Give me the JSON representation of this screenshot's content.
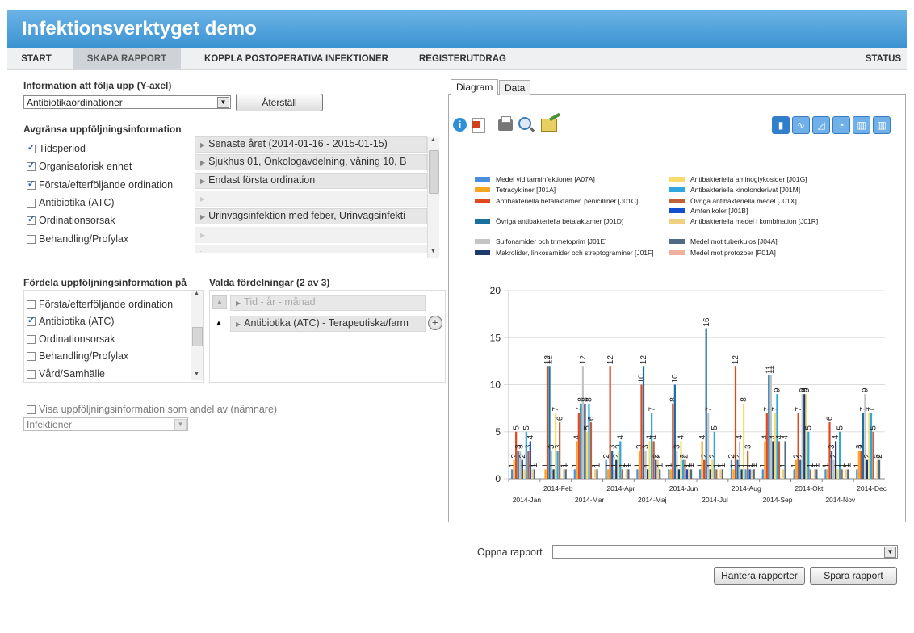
{
  "app": {
    "title": "Infektionsverktyget demo"
  },
  "nav": [
    {
      "label": "START",
      "active": false
    },
    {
      "label": "SKAPA RAPPORT",
      "active": true
    },
    {
      "label": "KOPPLA POSTOPERATIVA INFEKTIONER",
      "active": false
    },
    {
      "label": "REGISTERUTDRAG",
      "active": false
    },
    {
      "label": "STATUS",
      "active": false
    }
  ],
  "yaxis_section": {
    "heading": "Information att följa upp (Y-axel)",
    "select_value": "Antibiotikaordinationer",
    "reset_label": "Återställ"
  },
  "limit_section": {
    "heading": "Avgränsa uppföljningsinformation",
    "items": [
      {
        "label": "Tidsperiod",
        "checked": true,
        "filter": "Senaste året (2014-01-16 - 2015-01-15)"
      },
      {
        "label": "Organisatorisk enhet",
        "checked": true,
        "filter": "Sjukhus 01, Onkologavdelning, våning 10, B"
      },
      {
        "label": "Första/efterföljande ordination",
        "checked": true,
        "filter": "Endast första ordination"
      },
      {
        "label": "Antibiotika (ATC)",
        "checked": false,
        "filter": ""
      },
      {
        "label": "Ordinationsorsak",
        "checked": true,
        "filter": "Urinvägsinfektion med feber, Urinvägsinfekti"
      },
      {
        "label": "Behandling/Profylax",
        "checked": false,
        "filter": ""
      },
      {
        "label": "Vård/Samhälle",
        "checked": false,
        "filter": ""
      }
    ]
  },
  "dist_section": {
    "heading": "Fördela uppföljningsinformation på",
    "items": [
      {
        "label": "Första/efterföljande ordination",
        "checked": false
      },
      {
        "label": "Antibiotika (ATC)",
        "checked": true
      },
      {
        "label": "Ordinationsorsak",
        "checked": false
      },
      {
        "label": "Behandling/Profylax",
        "checked": false
      },
      {
        "label": "Vård/Samhälle",
        "checked": false
      }
    ],
    "selected_heading": "Valda fördelningar (2 av 3)",
    "selected": [
      {
        "label": "Tid - år - månad",
        "disabled": true
      },
      {
        "label": "Antibiotika (ATC) - Terapeutiska/farm",
        "disabled": false
      }
    ]
  },
  "share_section": {
    "label": "Visa uppföljningsinformation som andel av (nämnare)",
    "select_value": "Infektioner"
  },
  "tabs": [
    {
      "label": "Diagram",
      "active": true
    },
    {
      "label": "Data",
      "active": false
    }
  ],
  "toolbar_icons": [
    "info-icon",
    "pdf-export-icon",
    "print-icon",
    "zoom-icon",
    "chart-settings-icon"
  ],
  "charttype_icons": [
    "bar-chart-icon",
    "line-chart-icon",
    "area-chart-icon",
    "pie-chart-icon",
    "stacked-bar-icon",
    "stacked-bar-100-icon"
  ],
  "colors": {
    "A07A": "#4a8ee0",
    "J01A": "#f6a623",
    "J01C": "#e0481e",
    "J01D": "#1a6ea0",
    "J01E": "#c4c4c4",
    "J01F": "#1c3a6e",
    "J01G": "#f6dc6a",
    "J01M": "#2ea6e0",
    "J01X": "#c0603a",
    "J01B": "#1050d0",
    "J01R": "#f0cf80",
    "J04A": "#4e6a84",
    "P01A": "#f0b0a0"
  },
  "chart_data": {
    "type": "bar",
    "categories": [
      "2014-Jan",
      "2014-Feb",
      "2014-Mar",
      "2014-Apr",
      "2014-Maj",
      "2014-Jun",
      "2014-Jul",
      "2014-Aug",
      "2014-Sep",
      "2014-Okt",
      "2014-Nov",
      "2014-Dec"
    ],
    "ylim": [
      0,
      20
    ],
    "yticks": [
      0,
      5,
      10,
      15,
      20
    ],
    "grid": true,
    "legend_position": "top",
    "series": [
      {
        "name": "Medel vid tarminfektioner [A07A]",
        "code": "A07A",
        "values": [
          1,
          null,
          1,
          2,
          1,
          1,
          1,
          2,
          1,
          1,
          1,
          1
        ]
      },
      {
        "name": "Tetracykliner [J01A]",
        "code": "J01A",
        "values": [
          2,
          1,
          4,
          1,
          3,
          1,
          4,
          1,
          4,
          2,
          1,
          3
        ]
      },
      {
        "name": "Antibakteriella betalaktamer, penicilliner [J01C]",
        "code": "J01C",
        "values": [
          5,
          12,
          7,
          12,
          10,
          8,
          2,
          12,
          7,
          7,
          6,
          3
        ]
      },
      {
        "name": "Övriga antibakteriella betalaktamer [J01D]",
        "code": "J01D",
        "values": [
          3,
          12,
          8,
          3,
          12,
          10,
          16,
          2,
          11,
          2,
          3,
          7
        ]
      },
      {
        "name": "Sulfonamider och trimetoprim [J01E]",
        "code": "J01E",
        "values": [
          3,
          3,
          12,
          1,
          3,
          3,
          7,
          4,
          11,
          9,
          2,
          9
        ]
      },
      {
        "name": "Makrolider, linkosamider och streptograminer [J01F]",
        "code": "J01F",
        "values": [
          2,
          1,
          8,
          2,
          1,
          1,
          1,
          1,
          4,
          9,
          4,
          2
        ]
      },
      {
        "name": "Antibakteriella aminoglykosider [J01G]",
        "code": "J01G",
        "values": [
          1,
          7,
          5,
          3,
          4,
          4,
          2,
          8,
          7,
          9,
          1,
          7
        ]
      },
      {
        "name": "Antibakteriella kinolonderivat [J01M]",
        "code": "J01M",
        "values": [
          5,
          3,
          8,
          4,
          7,
          2,
          5,
          1,
          9,
          5,
          5,
          7
        ]
      },
      {
        "name": "Övriga antibakteriella medel [J01X]",
        "code": "J01X",
        "values": [
          3,
          6,
          6,
          1,
          4,
          2,
          1,
          3,
          4,
          1,
          1,
          5
        ]
      },
      {
        "name": "Amfenikoler [J01B]",
        "code": "J01B",
        "values": [
          4,
          null,
          null,
          null,
          2,
          1,
          null,
          1,
          null,
          null,
          null,
          null
        ]
      },
      {
        "name": "Antibakteriella medel i kombination [J01R]",
        "code": "J01R",
        "values": [
          1,
          1,
          1,
          1,
          2,
          1,
          1,
          1,
          1,
          1,
          1,
          2
        ]
      },
      {
        "name": "Medel mot tuberkulos [J04A]",
        "code": "J04A",
        "values": [
          1,
          1,
          1,
          1,
          1,
          1,
          1,
          1,
          4,
          1,
          1,
          2
        ]
      },
      {
        "name": "Medel mot protozoer [P01A]",
        "code": "P01A",
        "values": [
          null,
          null,
          null,
          null,
          null,
          null,
          null,
          null,
          null,
          null,
          null,
          null
        ]
      }
    ]
  },
  "report": {
    "open_label": "Öppna rapport",
    "select_value": "",
    "manage_label": "Hantera rapporter",
    "save_label": "Spara rapport"
  }
}
